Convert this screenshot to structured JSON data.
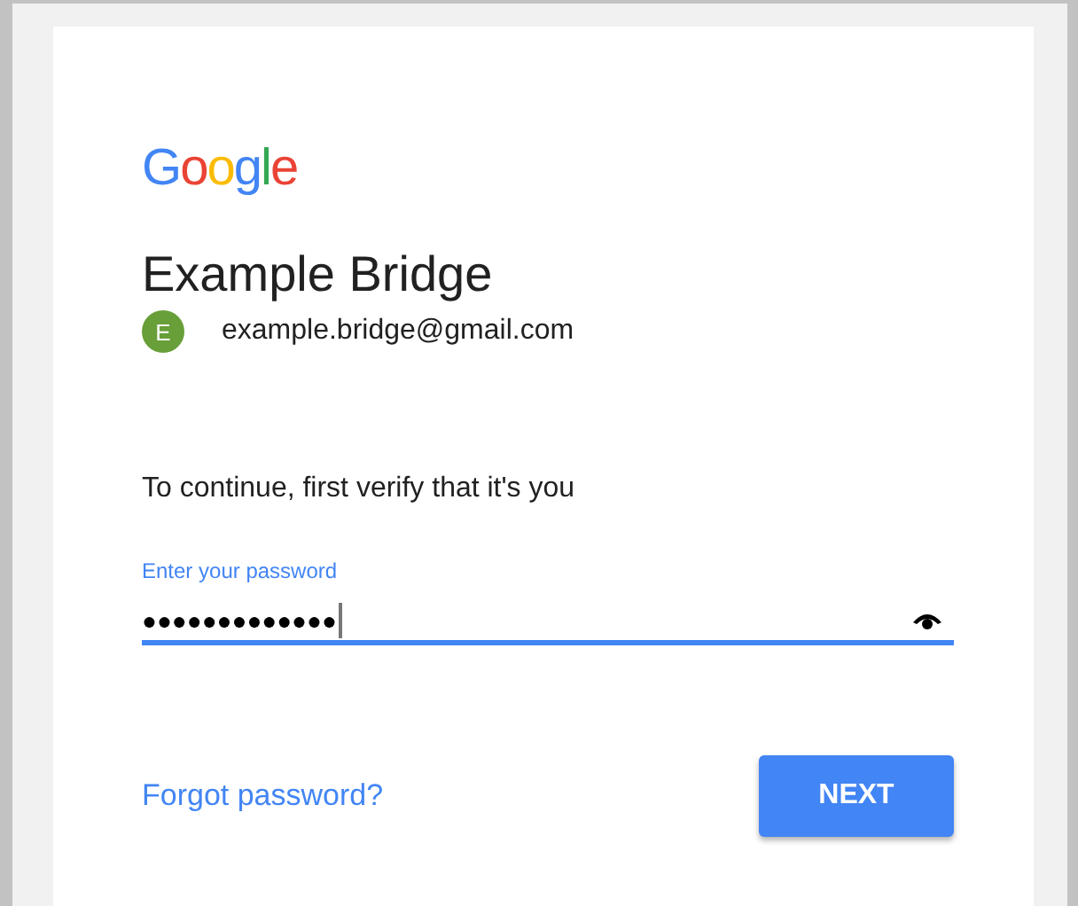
{
  "logo": "Google",
  "account": {
    "name": "Example Bridge",
    "initial": "E",
    "email": "example.bridge@gmail.com",
    "color": "#689f38"
  },
  "prompt": "To continue, first verify that it's you",
  "password_field": {
    "label": "Enter your password",
    "value": "●●●●●●●●●●●●●",
    "focused": true
  },
  "forgot_link": "Forgot password?",
  "next_button": "NEXT"
}
